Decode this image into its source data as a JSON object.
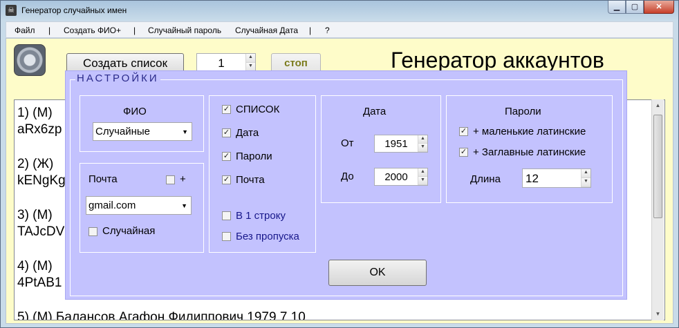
{
  "window": {
    "title": "Генератор случайных имен"
  },
  "menu": {
    "file": "Файл",
    "create_fio": "Создать ФИО+",
    "random_password": "Случайный пароль",
    "random_date": "Случайная Дата",
    "help": "?",
    "sep": "|"
  },
  "toolbar": {
    "create_list": "Создать список",
    "count": "1",
    "stop": "стоп",
    "heading": "Генератор аккаунтов"
  },
  "list": {
    "rows": [
      {
        "num": " 1)  (М)",
        "login": "aRx6zp"
      },
      {
        "num": " 2)  (Ж)",
        "login": "kENgKg"
      },
      {
        "num": " 3)  (М)",
        "login": "TAJcDV"
      },
      {
        "num": " 4)  (М)",
        "login": "4PtAB1"
      },
      {
        "num": " 5)  (М)       Балансов  Агафон  Филиппович       1979  7  10"
      }
    ]
  },
  "settings": {
    "title": "НАСТРОЙКИ",
    "fio": {
      "label": "ФИО",
      "value": "Случайные"
    },
    "mail": {
      "label": "Почта",
      "plus": "+",
      "plus_checked": false,
      "domain": "gmail.com",
      "random_label": "Случайная",
      "random_checked": false
    },
    "options": {
      "list": {
        "label": "СПИСОК",
        "checked": true
      },
      "date": {
        "label": "Дата",
        "checked": true
      },
      "passwords": {
        "label": "Пароли",
        "checked": true
      },
      "mail": {
        "label": "Почта",
        "checked": true
      },
      "one_line": {
        "label": "В 1 строку",
        "checked": false
      },
      "no_gap": {
        "label": "Без пропуска",
        "checked": false
      }
    },
    "date": {
      "title": "Дата",
      "from_label": "От",
      "from_value": "1951",
      "to_label": "До",
      "to_value": "2000"
    },
    "passwords": {
      "title": "Пароли",
      "lowercase_label": "+ маленькие латинские",
      "lowercase_checked": true,
      "uppercase_label": "+ Заглавные латинские",
      "uppercase_checked": true,
      "length_label": "Длина",
      "length_value": "12"
    },
    "ok": "OK"
  },
  "colors": {
    "panel": "#c3c2fe",
    "client": "#fefcc9",
    "stop_text": "#7a7a1a"
  }
}
